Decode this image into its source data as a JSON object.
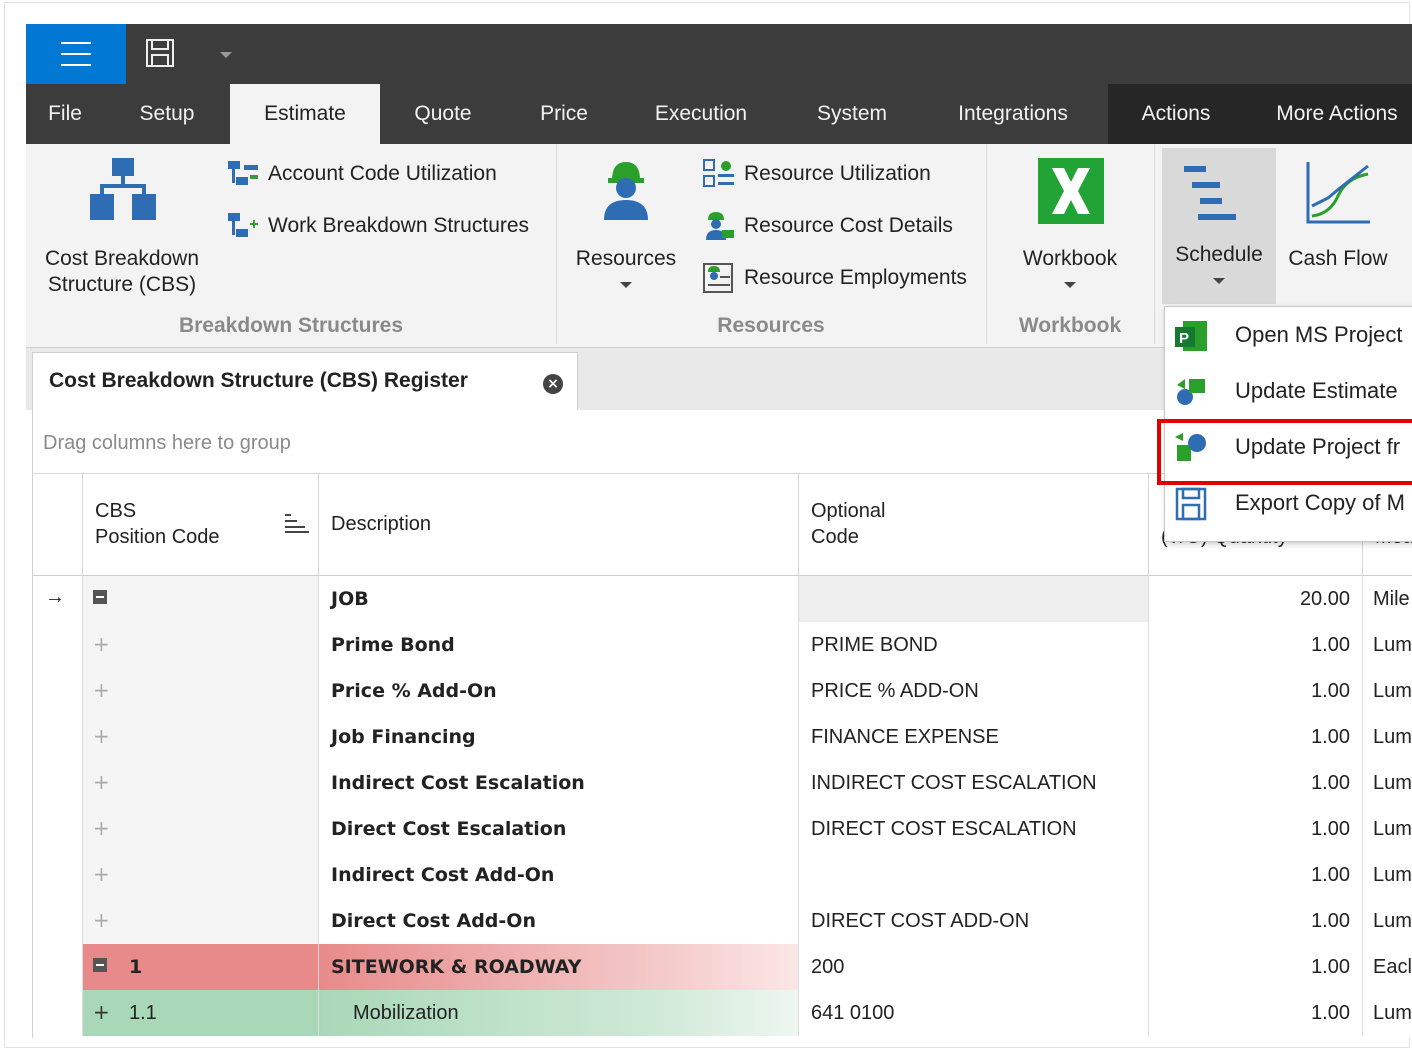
{
  "titlebar": {
    "menu_icon": "hamburger-icon",
    "save_icon": "save-icon",
    "dropdown_icon": "chevron-down-icon"
  },
  "tabs": [
    {
      "label": "File"
    },
    {
      "label": "Setup"
    },
    {
      "label": "Estimate",
      "active": true
    },
    {
      "label": "Quote"
    },
    {
      "label": "Price"
    },
    {
      "label": "Execution"
    },
    {
      "label": "System"
    },
    {
      "label": "Integrations"
    },
    {
      "label": "Actions"
    },
    {
      "label": "More Actions"
    }
  ],
  "ribbon": {
    "breakdown": {
      "cbs_label": "Cost Breakdown\nStructure (CBS)",
      "account_code": "Account Code Utilization",
      "wbs": "Work Breakdown Structures",
      "group_label": "Breakdown Structures"
    },
    "resources": {
      "resources_label": "Resources",
      "utilization": "Resource Utilization",
      "cost_details": "Resource Cost Details",
      "employments": "Resource Employments",
      "group_label": "Resources"
    },
    "workbook": {
      "label": "Workbook",
      "group_label": "Workbook"
    },
    "schedule": {
      "label": "Schedule"
    },
    "cashflow": {
      "label": "Cash Flow"
    }
  },
  "dropdown": {
    "items": [
      {
        "label": "Open MS Project",
        "icon": "ms-project-icon"
      },
      {
        "label": "Update Estimate",
        "icon": "update-estimate-icon"
      },
      {
        "label": "Update Project fr",
        "icon": "update-project-icon",
        "highlighted": true
      },
      {
        "label": "Export Copy of M",
        "icon": "export-copy-icon"
      }
    ]
  },
  "doc_tab": {
    "title": "Cost Breakdown Structure (CBS) Register",
    "close": "×"
  },
  "grid": {
    "group_hint": "Drag columns here to group",
    "columns": [
      {
        "label": "CBS\nPosition Code"
      },
      {
        "label": "Description"
      },
      {
        "label": "Optional\nCode"
      },
      {
        "label": "(T/O) Quantity"
      },
      {
        "label": "Mea"
      }
    ],
    "rows": [
      {
        "code": "",
        "desc": "JOB",
        "opt": "",
        "qty": "20.00",
        "unit": "Mile",
        "level": 0,
        "expander": "minus",
        "current": true
      },
      {
        "code": "",
        "desc": "Prime Bond",
        "opt": "PRIME BOND",
        "qty": "1.00",
        "unit": "Lum",
        "level": 1,
        "expander": "plus"
      },
      {
        "code": "",
        "desc": "Price % Add-On",
        "opt": "PRICE % ADD-ON",
        "qty": "1.00",
        "unit": "Lum",
        "level": 1,
        "expander": "plus"
      },
      {
        "code": "",
        "desc": "Job Financing",
        "opt": "FINANCE EXPENSE",
        "qty": "1.00",
        "unit": "Lum",
        "level": 1,
        "expander": "plus"
      },
      {
        "code": "",
        "desc": "Indirect Cost Escalation",
        "opt": "INDIRECT COST ESCALATION",
        "qty": "1.00",
        "unit": "Lum",
        "level": 1,
        "expander": "plus"
      },
      {
        "code": "",
        "desc": "Direct Cost Escalation",
        "opt": "DIRECT COST ESCALATION",
        "qty": "1.00",
        "unit": "Lum",
        "level": 1,
        "expander": "plus"
      },
      {
        "code": "",
        "desc": "Indirect Cost Add-On",
        "opt": "",
        "qty": "1.00",
        "unit": "Lum",
        "level": 1,
        "expander": "plus"
      },
      {
        "code": "",
        "desc": "Direct Cost Add-On",
        "opt": "DIRECT COST ADD-ON",
        "qty": "1.00",
        "unit": "Lum",
        "level": 1,
        "expander": "plus"
      },
      {
        "code": "1",
        "desc": "SITEWORK & ROADWAY",
        "opt": "200",
        "qty": "1.00",
        "unit": "Eacl",
        "level": 1,
        "expander": "minus",
        "style": "red"
      },
      {
        "code": "1.1",
        "desc": "Mobilization",
        "opt": "641 0100",
        "qty": "1.00",
        "unit": "Lum",
        "level": 2,
        "expander": "plus-dark",
        "style": "green"
      }
    ]
  },
  "colors": {
    "accent": "#0078d4",
    "titlebar": "#3c3c3c",
    "highlight_red": "#e30000",
    "row_red": "#e88a8a",
    "row_green": "#a9d8b8"
  }
}
